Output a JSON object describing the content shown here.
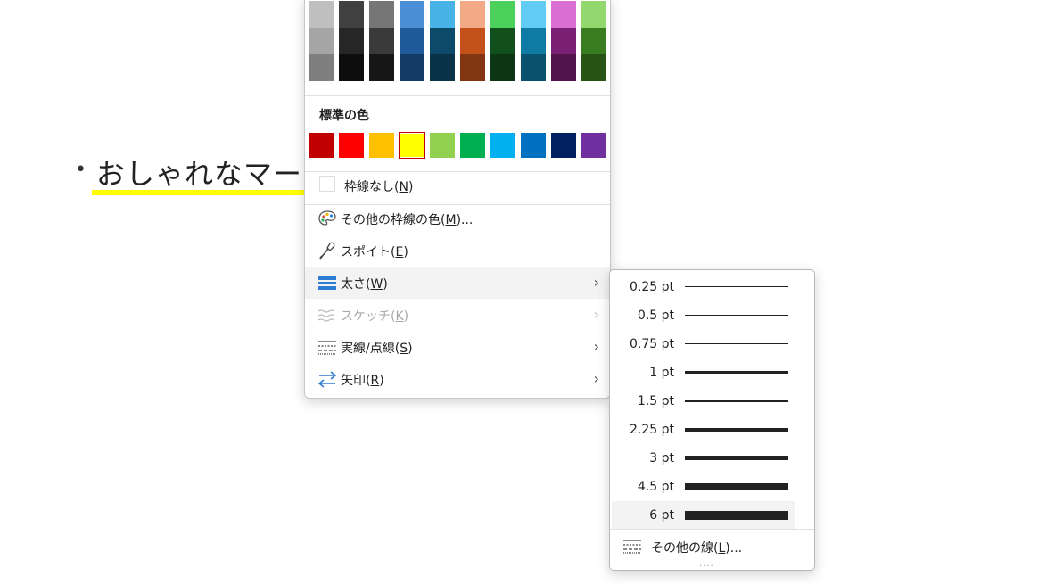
{
  "document": {
    "bullet": "•",
    "text": "おしゃれなマー"
  },
  "menu": {
    "theme_colors": [
      [
        "#bfbfbf",
        "#a5a5a5",
        "#7f7f7f"
      ],
      [
        "#404040",
        "#262626",
        "#0d0d0d"
      ],
      [
        "#767676",
        "#3a3a3a",
        "#171717"
      ],
      [
        "#4a8fd6",
        "#1f5a9a",
        "#143a66"
      ],
      [
        "#47b3e6",
        "#0d4a6a",
        "#0a3347"
      ],
      [
        "#f3a886",
        "#c4501a",
        "#823511"
      ],
      [
        "#4cd05c",
        "#114f1d",
        "#0c3514"
      ],
      [
        "#62cbf3",
        "#0f7aa3",
        "#0a516d"
      ],
      [
        "#da6fd2",
        "#7a1f74",
        "#51144d"
      ],
      [
        "#93d86f",
        "#3a7d20",
        "#275315"
      ]
    ],
    "standard_title": "標準の色",
    "standard_colors": [
      "#c00000",
      "#ff0000",
      "#ffc000",
      "#ffff00",
      "#92d050",
      "#00b050",
      "#00b0f0",
      "#0070c0",
      "#002060",
      "#7030a0"
    ],
    "selected_standard": 3,
    "no_border": {
      "label": "枠線なし(",
      "key": "N",
      "suffix": ")"
    },
    "items": [
      {
        "label": "その他の枠線の色(",
        "key": "M",
        "suffix": ")...",
        "icon": "palette-icon"
      },
      {
        "label": "スポイト(",
        "key": "E",
        "suffix": ")",
        "icon": "eyedropper-icon"
      },
      {
        "label": "太さ(",
        "key": "W",
        "suffix": ")",
        "icon": "line-weight-icon",
        "chevron": "›"
      },
      {
        "label": "スケッチ(",
        "key": "K",
        "suffix": ")",
        "icon": "sketch-icon",
        "chevron": "›"
      },
      {
        "label": "実線/点線(",
        "key": "S",
        "suffix": ")",
        "icon": "dash-icon",
        "chevron": "›"
      },
      {
        "label": "矢印(",
        "key": "R",
        "suffix": ")",
        "icon": "arrow-icon",
        "chevron": "›"
      }
    ]
  },
  "weights": [
    {
      "label": "0.25 pt",
      "thickness": 1
    },
    {
      "label": "0.5 pt",
      "thickness": 1
    },
    {
      "label": "0.75 pt",
      "thickness": 1
    },
    {
      "label": "1 pt",
      "thickness": 3
    },
    {
      "label": "1.5 pt",
      "thickness": 3
    },
    {
      "label": "2.25 pt",
      "thickness": 4
    },
    {
      "label": "3 pt",
      "thickness": 5
    },
    {
      "label": "4.5 pt",
      "thickness": 8
    },
    {
      "label": "6 pt",
      "thickness": 10
    }
  ],
  "more_lines": {
    "label": "その他の線(",
    "key": "L",
    "suffix": ")..."
  },
  "grip": "...."
}
